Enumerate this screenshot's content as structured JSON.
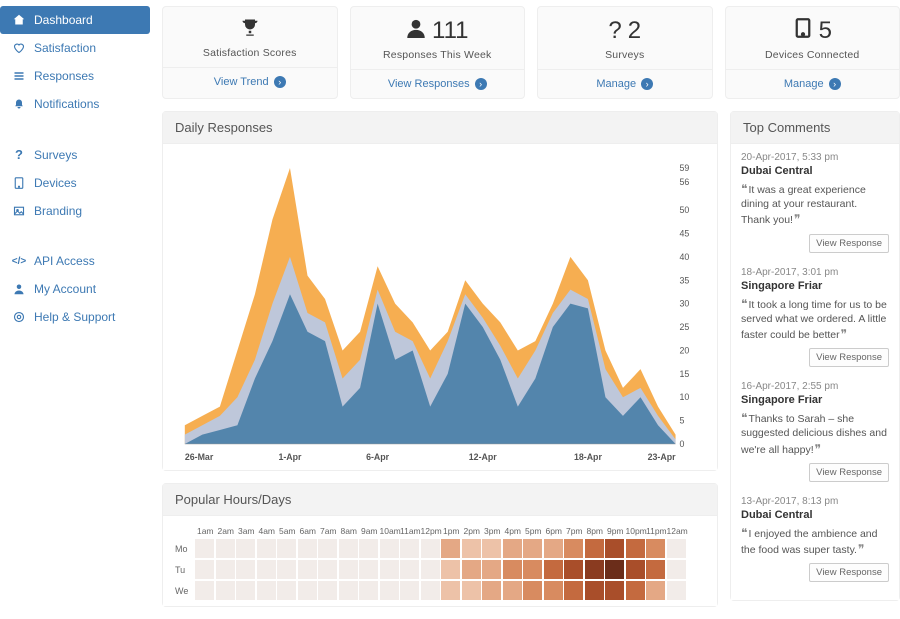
{
  "sidebar": {
    "groups": [
      {
        "items": [
          {
            "icon": "home",
            "label": "Dashboard",
            "active": true
          },
          {
            "icon": "heart",
            "label": "Satisfaction"
          },
          {
            "icon": "list",
            "label": "Responses"
          },
          {
            "icon": "bell",
            "label": "Notifications"
          }
        ]
      },
      {
        "items": [
          {
            "icon": "question",
            "label": "Surveys"
          },
          {
            "icon": "tablet",
            "label": "Devices"
          },
          {
            "icon": "image",
            "label": "Branding"
          }
        ]
      },
      {
        "items": [
          {
            "icon": "code",
            "label": "API Access"
          },
          {
            "icon": "user",
            "label": "My Account"
          },
          {
            "icon": "life-ring",
            "label": "Help & Support"
          }
        ]
      }
    ]
  },
  "stats": [
    {
      "icon": "trophy",
      "value": "",
      "title": "Satisfaction Scores",
      "action": "View Trend"
    },
    {
      "icon": "user",
      "value": "111",
      "title": "Responses This Week",
      "action": "View Responses"
    },
    {
      "icon": "question",
      "value": "2",
      "title": "Surveys",
      "action": "Manage"
    },
    {
      "icon": "tablet",
      "value": "5",
      "title": "Devices Connected",
      "action": "Manage"
    }
  ],
  "dailyResponses": {
    "title": "Daily Responses"
  },
  "popularHours": {
    "title": "Popular Hours/Days"
  },
  "topComments": {
    "title": "Top Comments",
    "items": [
      {
        "time": "20-Apr-2017, 5:33 pm",
        "location": "Dubai Central",
        "text": "It was a great experience dining at your restaurant. Thank you!",
        "action": "View Response"
      },
      {
        "time": "18-Apr-2017, 3:01 pm",
        "location": "Singapore Friar",
        "text": "It took a long time for us to be served what we ordered. A little faster could be better",
        "action": "View Response"
      },
      {
        "time": "16-Apr-2017, 2:55 pm",
        "location": "Singapore Friar",
        "text": "Thanks to Sarah – she suggested delicious dishes and we're all happy!",
        "action": "View Response"
      },
      {
        "time": "13-Apr-2017, 8:13 pm",
        "location": "Dubai Central",
        "text": "I enjoyed the ambience and the food was super tasty.",
        "action": "View Response"
      }
    ]
  },
  "chart_data": {
    "type": "area",
    "x_labels": [
      "26-Mar",
      "1-Apr",
      "6-Apr",
      "12-Apr",
      "18-Apr",
      "23-Apr"
    ],
    "y_ticks": [
      0,
      5,
      10,
      15,
      20,
      25,
      30,
      35,
      40,
      45,
      50,
      56,
      59
    ],
    "ylim": [
      0,
      59
    ],
    "days": 29,
    "series": [
      {
        "name": "series-c",
        "color": "#f5a742",
        "values": [
          4,
          6,
          8,
          20,
          32,
          48,
          59,
          36,
          31,
          20,
          24,
          38,
          30,
          26,
          20,
          24,
          35,
          30,
          26,
          20,
          22,
          30,
          40,
          35,
          20,
          12,
          16,
          8,
          2
        ]
      },
      {
        "name": "series-b",
        "color": "#b8c9e6",
        "values": [
          2,
          4,
          6,
          10,
          18,
          30,
          40,
          28,
          26,
          14,
          18,
          33,
          24,
          22,
          14,
          22,
          32,
          27,
          21,
          14,
          20,
          28,
          33,
          31,
          16,
          10,
          12,
          6,
          1
        ]
      },
      {
        "name": "series-a",
        "color": "#4a7fa8",
        "values": [
          0,
          2,
          3,
          4,
          14,
          22,
          32,
          24,
          22,
          8,
          12,
          30,
          18,
          20,
          8,
          15,
          30,
          25,
          18,
          8,
          14,
          25,
          30,
          29,
          10,
          6,
          10,
          4,
          0
        ]
      }
    ]
  },
  "heatmap_data": {
    "hours": [
      "1am",
      "2am",
      "3am",
      "4am",
      "5am",
      "6am",
      "7am",
      "8am",
      "9am",
      "10am",
      "11am",
      "12pm",
      "1pm",
      "2pm",
      "3pm",
      "4pm",
      "5pm",
      "6pm",
      "7pm",
      "8pm",
      "9pm",
      "10pm",
      "11pm",
      "12am"
    ],
    "rows": [
      {
        "label": "Mo",
        "values": [
          0,
          0,
          0,
          0,
          0,
          0,
          0,
          0,
          0,
          0,
          0,
          0,
          3,
          2,
          2,
          3,
          3,
          3,
          4,
          5,
          6,
          5,
          4,
          0
        ]
      },
      {
        "label": "Tu",
        "values": [
          0,
          0,
          0,
          0,
          0,
          0,
          0,
          0,
          0,
          0,
          0,
          0,
          2,
          3,
          3,
          4,
          4,
          5,
          6,
          7,
          8,
          6,
          5,
          0
        ]
      },
      {
        "label": "We",
        "values": [
          0,
          0,
          0,
          0,
          0,
          0,
          0,
          0,
          0,
          0,
          0,
          0,
          2,
          2,
          3,
          3,
          4,
          4,
          5,
          6,
          6,
          5,
          3,
          0
        ]
      }
    ],
    "color_scale": [
      "#f2ece9",
      "#f2d9cb",
      "#edc2a8",
      "#e4a885",
      "#d88b60",
      "#c46a3f",
      "#a94e2a",
      "#8a3b20",
      "#6b2d1a"
    ]
  },
  "icons": {
    "home": "⌂",
    "heart": "♡",
    "list": "≣",
    "bell": "🔔",
    "question": "?",
    "tablet": "▢",
    "image": "▣",
    "code": "</>",
    "user": "👤",
    "life-ring": "◎",
    "trophy": "🏆"
  }
}
